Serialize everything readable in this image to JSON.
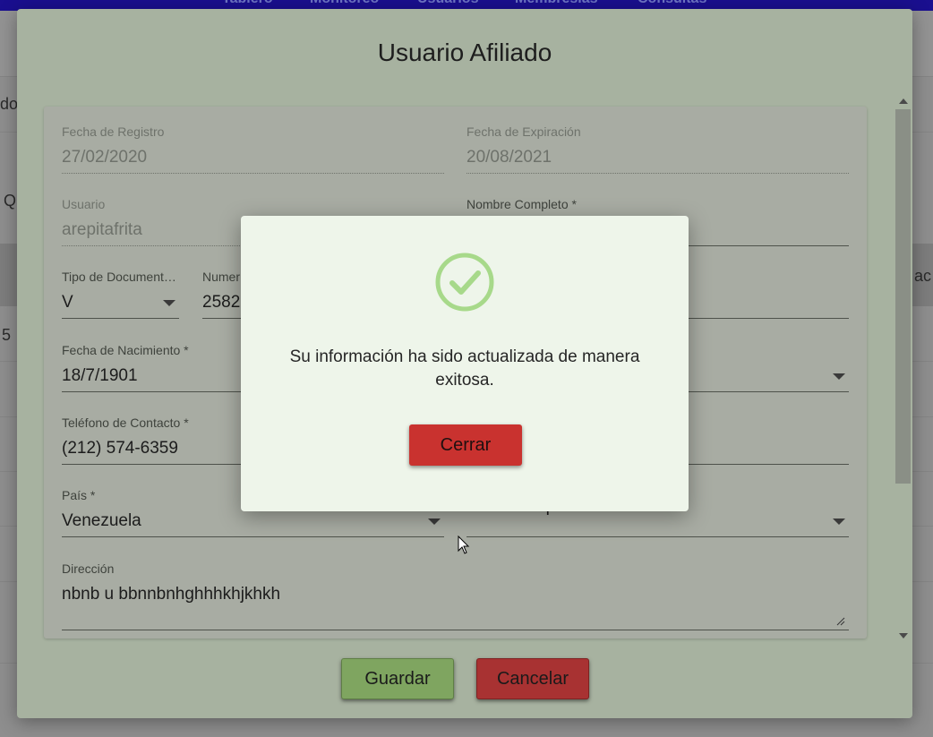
{
  "nav": {
    "items": [
      "Tablero",
      "Monitoreo",
      "Usuarios",
      "Membresías",
      "Consultas"
    ]
  },
  "background": {
    "left_text_1": "do",
    "left_text_2": "Q",
    "left_text_3": "5",
    "right_text": "ac"
  },
  "dialog": {
    "title": "Usuario Afiliado",
    "fields": {
      "fecha_registro": {
        "label": "Fecha de Registro",
        "value": "27/02/2020"
      },
      "fecha_expiracion": {
        "label": "Fecha de Expiración",
        "value": "20/08/2021"
      },
      "usuario": {
        "label": "Usuario",
        "value": "arepitafrita"
      },
      "nombre_completo": {
        "label": "Nombre Completo *",
        "value": ""
      },
      "tipo_documento": {
        "label": "Tipo de Documento...",
        "value": "V"
      },
      "numero_documento": {
        "label": "Numer",
        "value": "2582"
      },
      "fecha_nacimiento": {
        "label": "Fecha de Nacimiento *",
        "value": "18/7/1901"
      },
      "telefono": {
        "label": "Teléfono de Contacto *",
        "value": "(212) 574-6359"
      },
      "pais": {
        "label": "País *",
        "value": "Venezuela"
      },
      "estado": {
        "label": "",
        "value": "Distrito Capital"
      },
      "direccion": {
        "label": "Dirección",
        "value": "nbnb u bbnnbnhghhhkhjkhkh"
      }
    },
    "buttons": {
      "save": "Guardar",
      "cancel": "Cancelar"
    }
  },
  "modal": {
    "message": "Su información ha sido actualizada de manera exitosa.",
    "close": "Cerrar",
    "icon": "check-circle-icon"
  },
  "colors": {
    "success_green": "#a7d98a",
    "save_button": "#7fa560",
    "danger_button": "#c9322f"
  }
}
